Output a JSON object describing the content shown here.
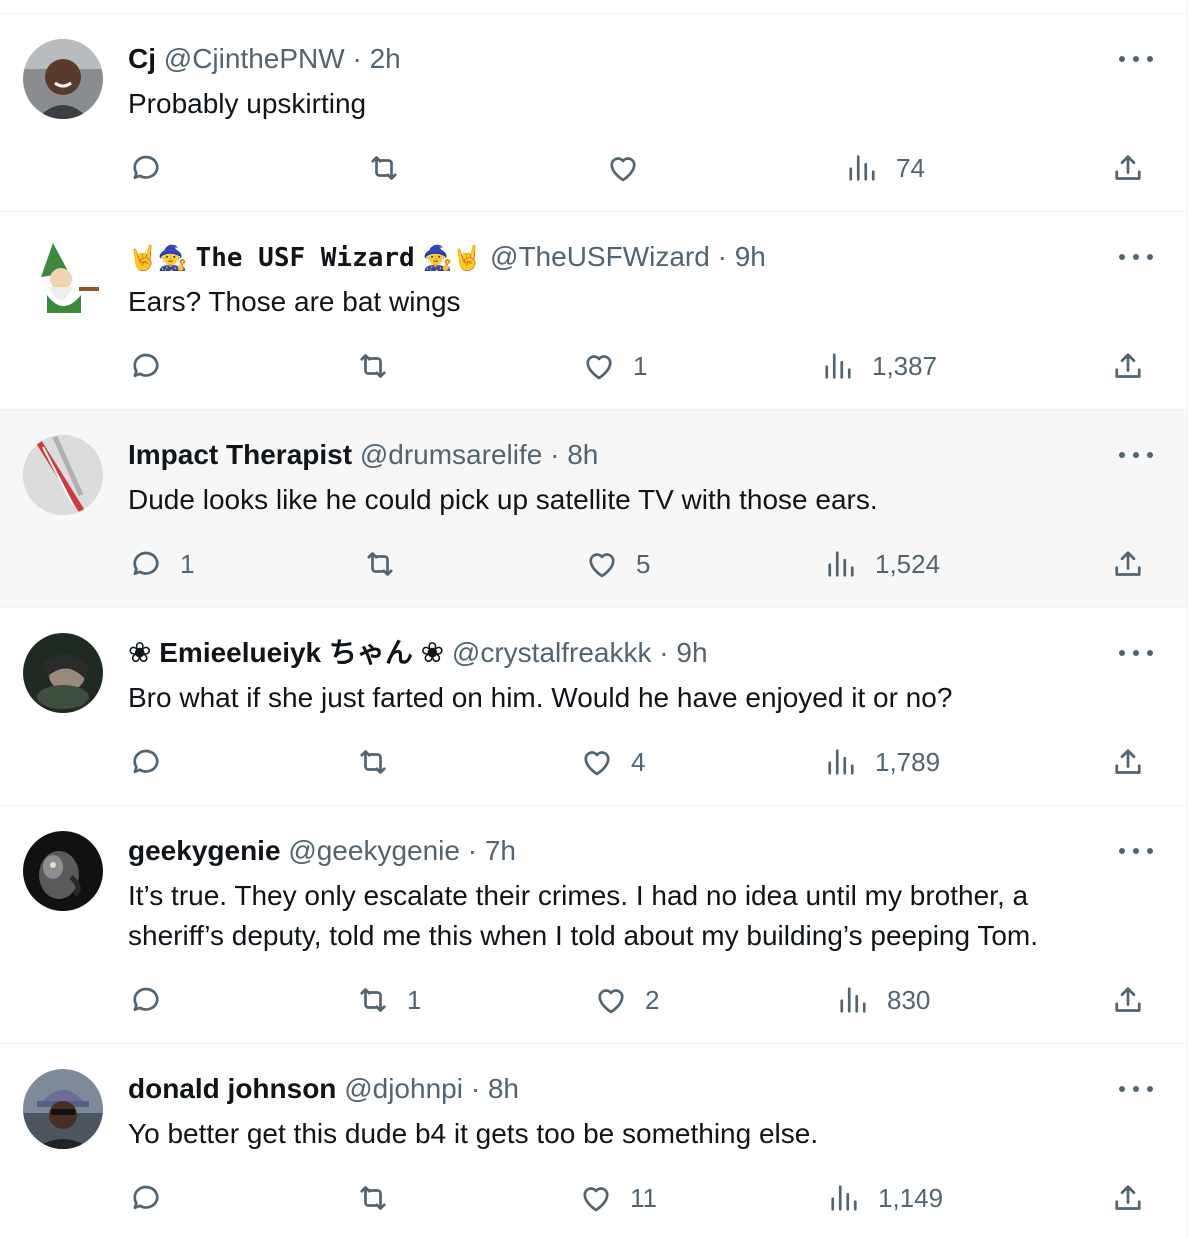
{
  "tweets": [
    {
      "name": "Cj",
      "handle": "@CjinthePNW",
      "time": "2h",
      "text": "Probably upskirting",
      "replies": "",
      "retweets": "",
      "likes": "",
      "views": "74"
    },
    {
      "name_prefix": "🤘🧙",
      "name": "The USF Wizard",
      "name_suffix": "🧙🤘",
      "handle": "@TheUSFWizard",
      "time": "9h",
      "text": "Ears? Those are bat wings",
      "replies": "",
      "retweets": "",
      "likes": "1",
      "views": "1,387"
    },
    {
      "name": "Impact Therapist",
      "handle": "@drumsarelife",
      "time": "8h",
      "text": "Dude looks like he could pick up satellite TV with those ears.",
      "replies": "1",
      "retweets": "",
      "likes": "5",
      "views": "1,524"
    },
    {
      "name": "❀ Emieelueiyk ちゃん ❀",
      "handle": "@crystalfreakkk",
      "time": "9h",
      "text": "Bro what if she just farted on him. Would he have enjoyed it or no?",
      "replies": "",
      "retweets": "",
      "likes": "4",
      "views": "1,789"
    },
    {
      "name": "geekygenie",
      "handle": "@geekygenie",
      "time": "7h",
      "text_line1": "It’s true. They only escalate their crimes. I had no idea until my brother, a",
      "text_line2": "sheriff’s deputy, told me this when I told about my building’s peeping Tom.",
      "replies": "",
      "retweets": "1",
      "likes": "2",
      "views": "830"
    },
    {
      "name": "donald johnson",
      "handle": "@djohnpi",
      "time": "8h",
      "text": "Yo better get this dude b4 it gets too be something else.",
      "replies": "",
      "retweets": "",
      "likes": "11",
      "views": "1,149"
    }
  ],
  "separator": "·",
  "icons": {
    "reply": "speech-bubble-icon",
    "retweet": "retweet-arrows-icon",
    "like": "heart-icon",
    "views": "bar-chart-icon",
    "share": "share-upload-icon",
    "more": "ellipsis-icon"
  },
  "colors": {
    "text": "#0f1419",
    "muted": "#536471",
    "divider": "#eff3f4",
    "highlight": "#f7f7f7"
  }
}
